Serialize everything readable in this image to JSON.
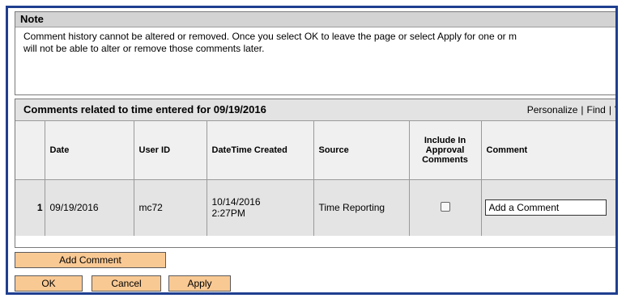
{
  "note": {
    "title": "Note",
    "line1": "Comment history cannot be altered or removed. Once you select OK to leave the page or select Apply for one or m",
    "line2": "will not be able to alter or remove those comments later."
  },
  "grid": {
    "title": "Comments related to time entered for 09/19/2016",
    "links": [
      "Personalize",
      "Find",
      "V"
    ],
    "columns": [
      "",
      "Date",
      "User ID",
      "DateTime Created",
      "Source",
      "Include in Approval Comments",
      "Comment"
    ],
    "header_include_lines": [
      "Include In",
      "Approval",
      "Comments"
    ],
    "rows": [
      {
        "num": "1",
        "date": "09/19/2016",
        "user_id": "mc72",
        "datetime_line1": "10/14/2016",
        "datetime_line2": "2:27PM",
        "source": "Time Reporting",
        "include_checked": false,
        "comment": "Add a Comment"
      }
    ]
  },
  "buttons": {
    "add_comment": "Add Comment",
    "ok": "OK",
    "cancel": "Cancel",
    "apply": "Apply"
  },
  "colors": {
    "frame_border": "#1f3f8f",
    "button_bg": "#f9c994",
    "header_bg": "#e3e3e3"
  }
}
